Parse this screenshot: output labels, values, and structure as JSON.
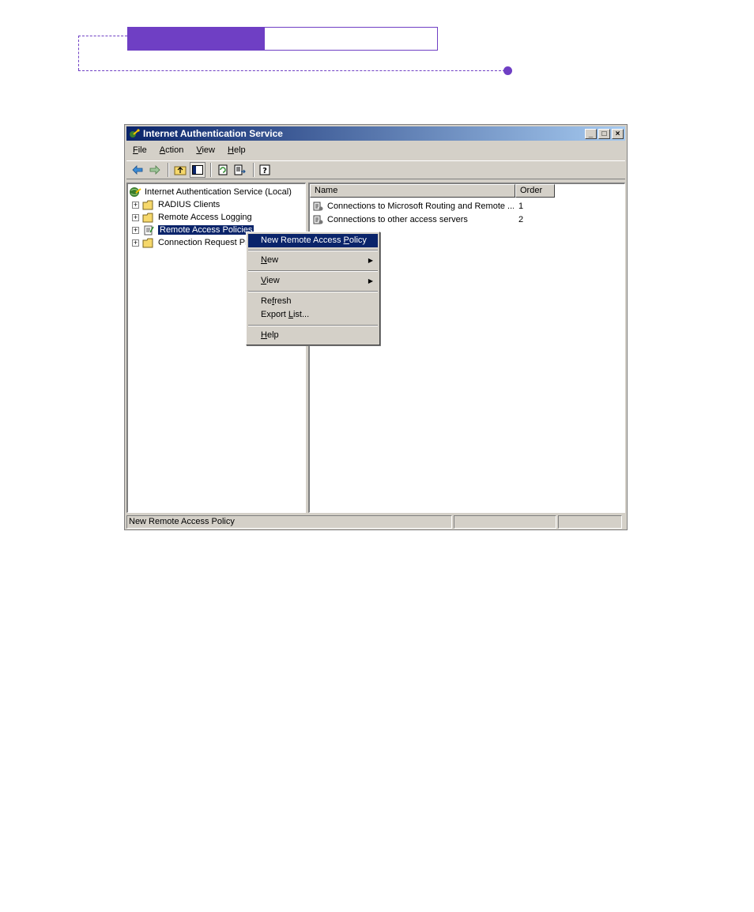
{
  "window": {
    "title": "Internet Authentication Service",
    "minimize_glyph": "_",
    "maximize_glyph": "□",
    "close_glyph": "×"
  },
  "menubar": {
    "file": {
      "accel": "F",
      "rest": "ile"
    },
    "action": {
      "accel": "A",
      "rest": "ction"
    },
    "view": {
      "accel": "V",
      "rest": "iew"
    },
    "help": {
      "accel": "H",
      "rest": "elp"
    }
  },
  "toolbar": {
    "icons": [
      "back-icon",
      "forward-icon",
      "up-folder-icon",
      "show-hide-tree-icon",
      "refresh-icon",
      "export-list-icon",
      "help-icon"
    ]
  },
  "tree": {
    "root": "Internet Authentication Service (Local)",
    "items": [
      {
        "label": "RADIUS Clients",
        "expander": "+"
      },
      {
        "label": "Remote Access Logging",
        "expander": "+"
      },
      {
        "label": "Remote Access Policies",
        "expander": "+"
      },
      {
        "label": "Connection Request Pr",
        "expander": "+"
      }
    ]
  },
  "list": {
    "columns": [
      "Name",
      "Order"
    ],
    "rows": [
      {
        "name": "Connections to Microsoft Routing and Remote ...",
        "order": "1"
      },
      {
        "name": "Connections to other access servers",
        "order": "2"
      }
    ]
  },
  "statusbar": {
    "text": "New Remote Access Policy"
  },
  "context_menu": {
    "new_policy": {
      "before": "New Remote Access ",
      "accel": "P",
      "after": "olicy"
    },
    "new": {
      "accel": "N",
      "after": "ew"
    },
    "view": {
      "accel": "V",
      "after": "iew"
    },
    "refresh": {
      "before": "Re",
      "accel": "f",
      "after": "resh"
    },
    "export": {
      "before": "Export ",
      "accel": "L",
      "after": "ist..."
    },
    "help": {
      "accel": "H",
      "after": "elp"
    },
    "submenu_arrow": "▶"
  },
  "colors": {
    "accent": "#6f3fc4",
    "title_active": "#0a246a",
    "face": "#d4d0c8"
  }
}
